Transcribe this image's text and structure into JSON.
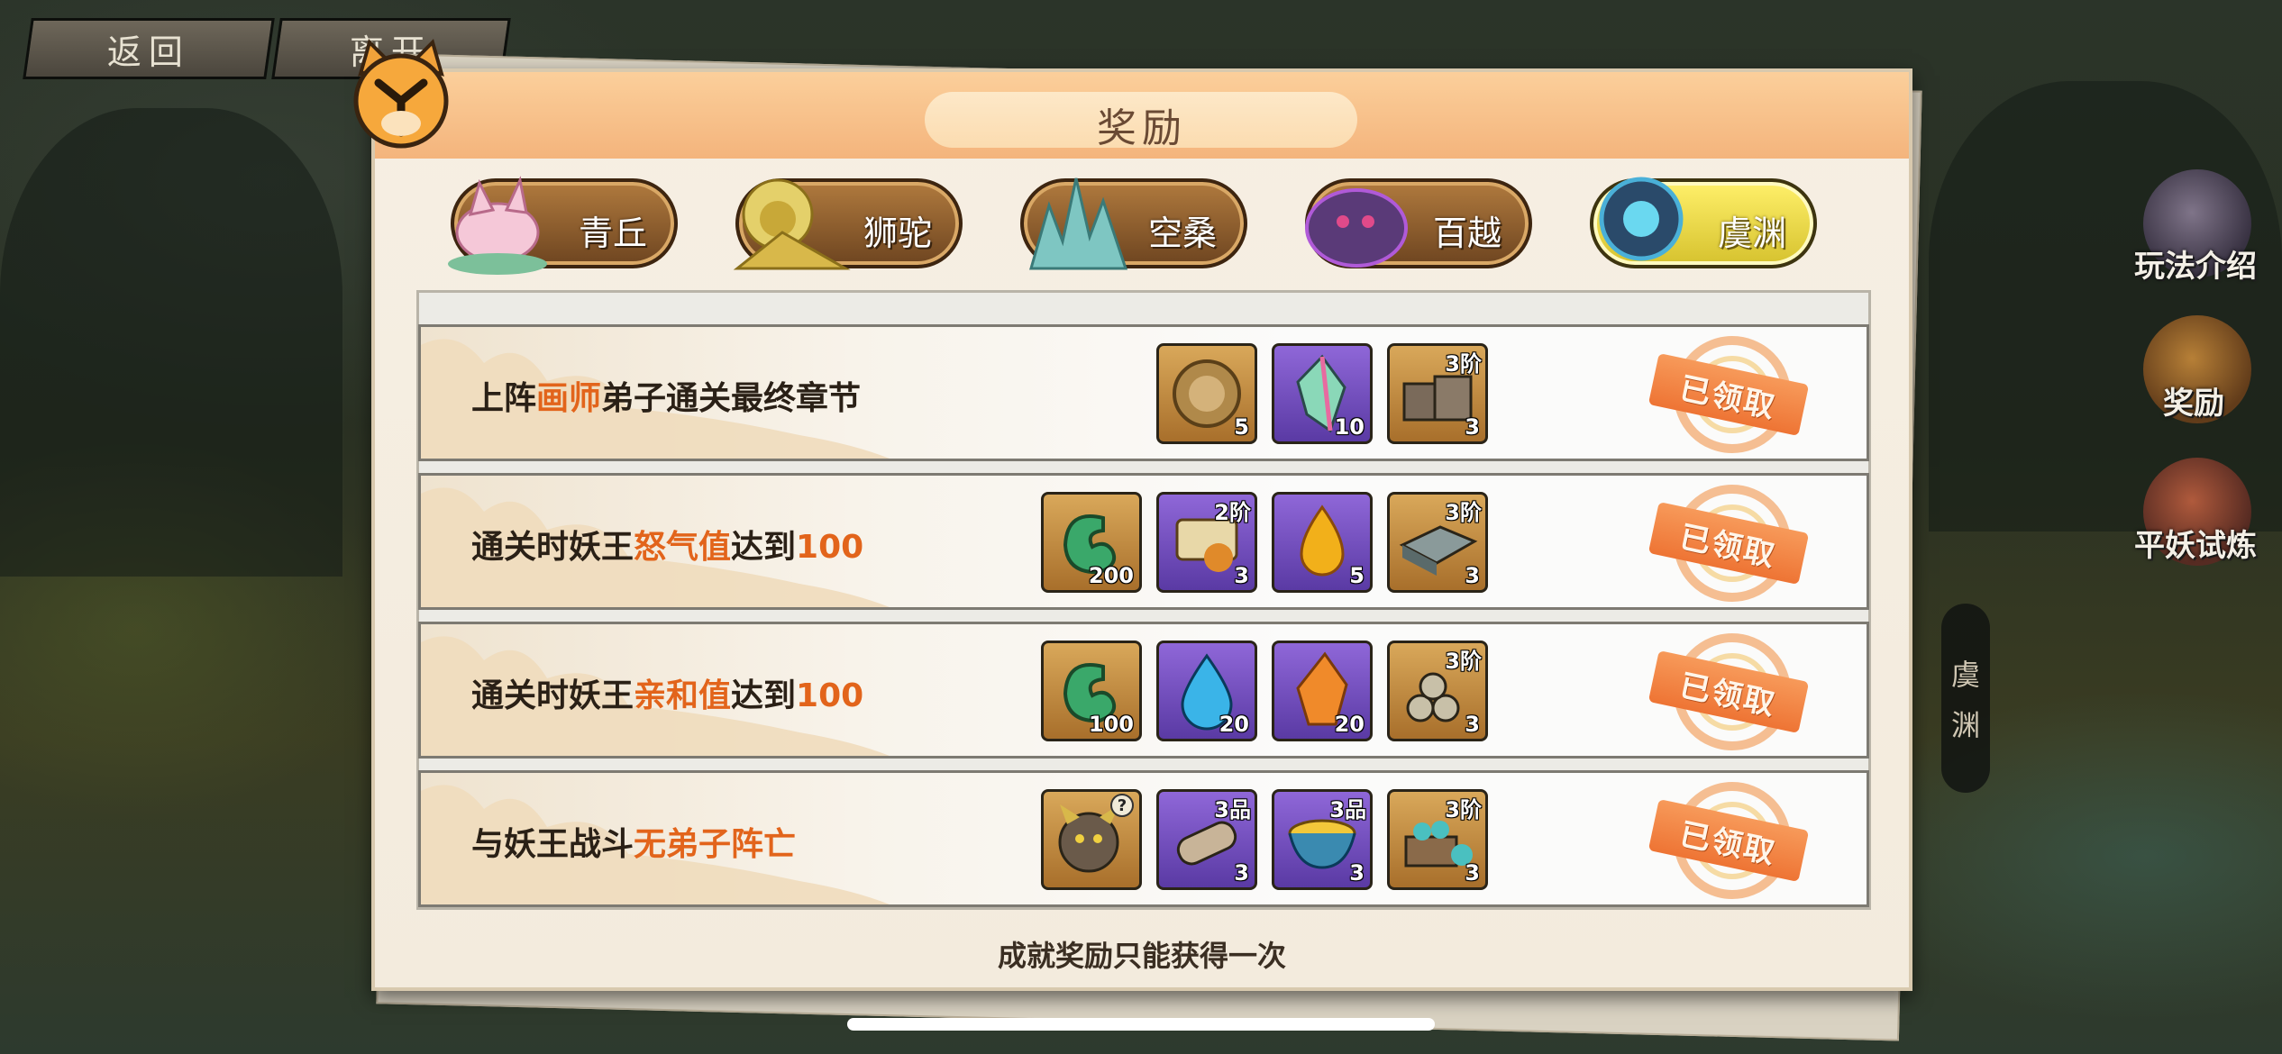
{
  "nav": {
    "back_label": "返回",
    "leave_label": "离开"
  },
  "panel": {
    "title": "奖励",
    "footer_note": "成就奖励只能获得一次"
  },
  "side": {
    "play_intro": "玩法介绍",
    "rewards": "奖励",
    "trial": "平妖试炼",
    "region_tab": [
      "虞",
      "渊"
    ]
  },
  "tabs": [
    {
      "label": "青丘",
      "active": false
    },
    {
      "label": "狮驼",
      "active": false
    },
    {
      "label": "空桑",
      "active": false
    },
    {
      "label": "百越",
      "active": false
    },
    {
      "label": "虞渊",
      "active": true
    }
  ],
  "achievements": [
    {
      "text_parts": [
        "上阵",
        "画师",
        "弟子通关最终章节"
      ],
      "status": "已领取",
      "items": [
        {
          "icon": "coin-icon",
          "frame": "gold",
          "count": "5",
          "tier": ""
        },
        {
          "icon": "crystal-icon",
          "frame": "purple",
          "count": "10",
          "tier": ""
        },
        {
          "icon": "crate-icon",
          "frame": "gold",
          "count": "3",
          "tier": "3阶"
        }
      ]
    },
    {
      "text_parts": [
        "通关时妖王",
        "怒气值",
        "达到",
        "100"
      ],
      "status": "已领取",
      "items": [
        {
          "icon": "jade-icon",
          "frame": "gold",
          "count": "200",
          "tier": ""
        },
        {
          "icon": "scroll-icon",
          "frame": "purple",
          "count": "3",
          "tier": "2阶"
        },
        {
          "icon": "fire-orb-icon",
          "frame": "purple",
          "count": "5",
          "tier": ""
        },
        {
          "icon": "tray-icon",
          "frame": "gold",
          "count": "3",
          "tier": "3阶"
        }
      ]
    },
    {
      "text_parts": [
        "通关时妖王",
        "亲和值",
        "达到",
        "100"
      ],
      "status": "已领取",
      "items": [
        {
          "icon": "jade-icon",
          "frame": "gold",
          "count": "100",
          "tier": ""
        },
        {
          "icon": "water-drop-icon",
          "frame": "purple",
          "count": "20",
          "tier": ""
        },
        {
          "icon": "amber-crystal-icon",
          "frame": "purple",
          "count": "20",
          "tier": ""
        },
        {
          "icon": "logs-icon",
          "frame": "gold",
          "count": "3",
          "tier": "3阶"
        }
      ]
    },
    {
      "text_parts": [
        "与妖王战斗",
        "无弟子阵亡"
      ],
      "status": "已领取",
      "items": [
        {
          "icon": "monster-portrait-icon",
          "frame": "gold",
          "count": "",
          "tier": "",
          "unknown": "?"
        },
        {
          "icon": "log-scroll-icon",
          "frame": "purple",
          "count": "3",
          "tier": "3品"
        },
        {
          "icon": "bowl-icon",
          "frame": "purple",
          "count": "3",
          "tier": "3品"
        },
        {
          "icon": "ore-cart-icon",
          "frame": "gold",
          "count": "3",
          "tier": "3阶"
        }
      ]
    }
  ]
}
